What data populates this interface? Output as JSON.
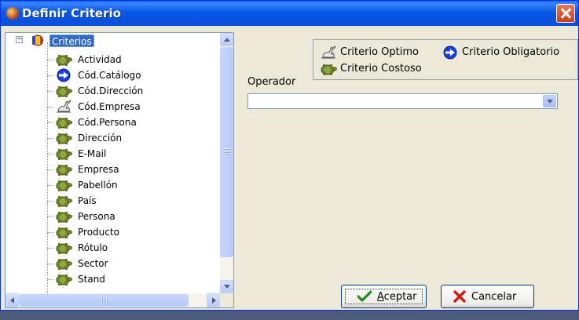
{
  "window": {
    "title": "Definir Criterio",
    "close_label": "×"
  },
  "tree": {
    "root_label": "Criterios",
    "expander": "−",
    "items": [
      {
        "label": "Actividad",
        "icon": "turtle-icon"
      },
      {
        "label": "Cód.Catálogo",
        "icon": "arrow-circle-icon"
      },
      {
        "label": "Cód.Dirección",
        "icon": "turtle-icon"
      },
      {
        "label": "Cód.Empresa",
        "icon": "rabbit-icon"
      },
      {
        "label": "Cód.Persona",
        "icon": "turtle-icon"
      },
      {
        "label": "Dirección",
        "icon": "turtle-icon"
      },
      {
        "label": "E-Mail",
        "icon": "turtle-icon"
      },
      {
        "label": "Empresa",
        "icon": "turtle-icon"
      },
      {
        "label": "Pabellón",
        "icon": "turtle-icon"
      },
      {
        "label": "País",
        "icon": "turtle-icon"
      },
      {
        "label": "Persona",
        "icon": "turtle-icon"
      },
      {
        "label": "Producto",
        "icon": "turtle-icon"
      },
      {
        "label": "Rótulo",
        "icon": "turtle-icon"
      },
      {
        "label": "Sector",
        "icon": "turtle-icon"
      },
      {
        "label": "Stand",
        "icon": "turtle-icon"
      }
    ]
  },
  "legend": {
    "optimo": "Criterio Optimo",
    "obligatorio": "Criterio Obligatorio",
    "costoso": "Criterio Costoso"
  },
  "operador": {
    "label": "Operador",
    "value": ""
  },
  "buttons": {
    "aceptar_u": "A",
    "aceptar_rest": "ceptar",
    "cancelar": "Cancelar"
  },
  "colors": {
    "title_bar": "#0a58e8",
    "selection": "#316ac5",
    "window_bg": "#ece9d8",
    "turtle_shell": "#6b8a2a",
    "arrow_blue": "#1a3fe0"
  }
}
